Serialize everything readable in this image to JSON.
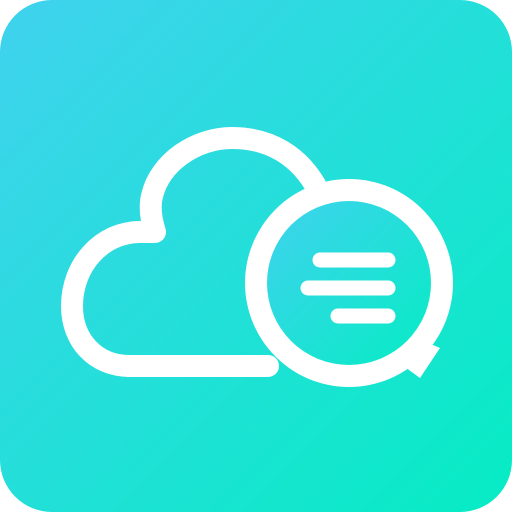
{
  "icon": {
    "name": "cloud-chat-app-icon",
    "symbol": "cloud-with-chat-bubble",
    "colors": {
      "gradient_start": "#40D2EE",
      "gradient_end": "#06ECC4",
      "glyph": "#ffffff"
    }
  }
}
